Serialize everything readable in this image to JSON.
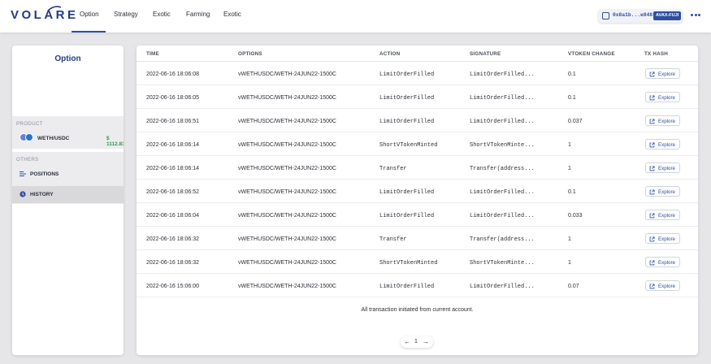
{
  "brand": {
    "name": "VOLARE"
  },
  "nav": {
    "tabs": [
      {
        "label": "Option",
        "active": true
      },
      {
        "label": "Strategy"
      },
      {
        "label": "Exotic"
      },
      {
        "label": "Farming"
      },
      {
        "label": "Exotic"
      }
    ]
  },
  "wallet": {
    "address": "0x8a1b...e848",
    "network": "AVAX-FUJI",
    "more_icon": "more-horizontal-icon"
  },
  "sidebar": {
    "title": "Option",
    "product_label": "PRODUCT",
    "product": {
      "name": "WETH/USDC",
      "price": "$ 1112.83"
    },
    "others_label": "OTHERS",
    "items": [
      {
        "label": "POSITIONS",
        "icon": "list-icon"
      },
      {
        "label": "HISTORY",
        "icon": "history-icon",
        "selected": true
      }
    ]
  },
  "table": {
    "headers": [
      "TIME",
      "OPTIONS",
      "ACTION",
      "SIGNATURE",
      "VTOKEN CHANGE",
      "TX HASH"
    ],
    "explore_label": "Explore",
    "rows": [
      {
        "time": "2022-06-16 18:06:08",
        "option": "vWETHUSDC/WETH-24JUN22-1500C",
        "action": "LimitOrderFilled",
        "signature": "LimitOrderFilled...",
        "change": "0.1"
      },
      {
        "time": "2022-06-16 18:06:05",
        "option": "vWETHUSDC/WETH-24JUN22-1500C",
        "action": "LimitOrderFilled",
        "signature": "LimitOrderFilled...",
        "change": "0.1"
      },
      {
        "time": "2022-06-16 18:06:51",
        "option": "vWETHUSDC/WETH-24JUN22-1500C",
        "action": "LimitOrderFilled",
        "signature": "LimitOrderFilled...",
        "change": "0.037"
      },
      {
        "time": "2022-06-16 18:06:14",
        "option": "vWETHUSDC/WETH-24JUN22-1500C",
        "action": "ShortVTokenMinted",
        "signature": "ShortVTokenMinte...",
        "change": "1"
      },
      {
        "time": "2022-06-16 18:06:14",
        "option": "vWETHUSDC/WETH-24JUN22-1500C",
        "action": "Transfer",
        "signature": "Transfer(address...",
        "change": "1"
      },
      {
        "time": "2022-06-16 18:06:52",
        "option": "vWETHUSDC/WETH-24JUN22-1500C",
        "action": "LimitOrderFilled",
        "signature": "LimitOrderFilled...",
        "change": "0.1"
      },
      {
        "time": "2022-06-16 18:06:04",
        "option": "vWETHUSDC/WETH-24JUN22-1500C",
        "action": "LimitOrderFilled",
        "signature": "LimitOrderFilled...",
        "change": "0.033"
      },
      {
        "time": "2022-06-16 18:06:32",
        "option": "vWETHUSDC/WETH-24JUN22-1500C",
        "action": "Transfer",
        "signature": "Transfer(address...",
        "change": "1"
      },
      {
        "time": "2022-06-16 18:06:32",
        "option": "vWETHUSDC/WETH-24JUN22-1500C",
        "action": "ShortVTokenMinted",
        "signature": "ShortVTokenMinte...",
        "change": "1"
      },
      {
        "time": "2022-06-16 15:06:00",
        "option": "vWETHUSDC/WETH-24JUN22-1500C",
        "action": "LimitOrderFilled",
        "signature": "LimitOrderFilled...",
        "change": "0.07"
      }
    ],
    "footnote": "All transaction initiated from current account."
  },
  "pagination": {
    "page": "1",
    "prev": "←",
    "next": "→"
  },
  "colors": {
    "accent": "#2e4ea0",
    "brand": "#233a86",
    "price_up": "#2e9a4a"
  }
}
